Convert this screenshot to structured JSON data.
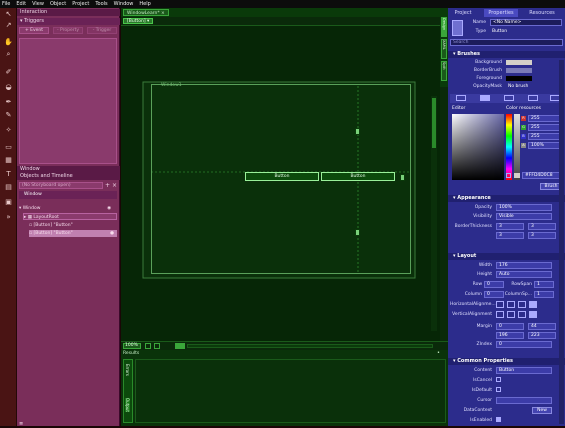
{
  "menu": [
    "File",
    "Edit",
    "View",
    "Object",
    "Project",
    "Tools",
    "Window",
    "Help"
  ],
  "toolbox": {
    "icons": [
      "pointer-icon",
      "direct-select-icon",
      "pan-icon",
      "zoom-icon",
      "eyedropper-icon",
      "paint-bucket-icon",
      "pen-icon",
      "pencil-icon",
      "brush-transform-icon",
      "rectangle-icon",
      "grid-icon",
      "text-icon",
      "textblock-icon",
      "camera-icon",
      "assets-icon"
    ]
  },
  "interaction": {
    "title": "Interaction",
    "triggers_label": "Triggers",
    "event_button": "+ Event",
    "trigger_btn2": "- Property",
    "trigger_btn3": "- Trigger",
    "default_item": "Window",
    "objects_title": "Objects and Timeline",
    "search_placeholder": "(No Storyboard open)",
    "tree": [
      "Window",
      "LayoutRoot",
      "[Button] \"Button\"",
      "[Button] \"Button\""
    ]
  },
  "document": {
    "tab": "WindowLearn*",
    "crumb": "[Button] ▾",
    "window_label": "Window1",
    "button1": "Button",
    "button2": "Button",
    "zoom": "100%",
    "side_tabs": [
      "Design",
      "XAML",
      "Split"
    ]
  },
  "results": {
    "title": "Results",
    "tabs": [
      "Errors",
      "Output"
    ]
  },
  "properties": {
    "tabs": [
      "Project",
      "Properties",
      "Resources"
    ],
    "name_label": "Name",
    "name_value": "<No Name>",
    "type_label": "Type",
    "type_value": "Button",
    "search_placeholder": "Search",
    "brushes_title": "Brushes",
    "brushes": [
      "Background",
      "BorderBrush",
      "Foreground",
      "OpacityMask"
    ],
    "opacity_mask_value": "No brush",
    "editor_label": "Editor",
    "color_resources": "Color resources",
    "rgba": [
      {
        "k": "R",
        "v": "255"
      },
      {
        "k": "G",
        "v": "255"
      },
      {
        "k": "B",
        "v": "255"
      },
      {
        "k": "A",
        "v": "100%"
      }
    ],
    "hex": "#FFD4D0C8",
    "brush_btn": "Brush",
    "appearance_title": "Appearance",
    "opacity_label": "Opacity",
    "opacity_value": "100%",
    "visibility_label": "Visibility",
    "visibility_value": "Visible",
    "border_label": "BorderThickness",
    "border_values": [
      "3",
      "3",
      "3",
      "3"
    ],
    "layout_title": "Layout",
    "width_label": "Width",
    "width_value": "176",
    "height_label": "Height",
    "height_value": "Auto",
    "row_label": "Row",
    "row_value": "0",
    "rowspan_label": "RowSpan",
    "rowspan_value": "1",
    "column_label": "Column",
    "column_value": "0",
    "colspan_label": "ColumnSp...",
    "colspan_value": "1",
    "halign_label": "HorizontalAlignme...",
    "valign_label": "VerticalAlignment",
    "margin_label": "Margin",
    "margin_values": [
      "0",
      "44",
      "196",
      "223"
    ],
    "zindex_label": "ZIndex",
    "zindex_value": "0",
    "common_title": "Common Properties",
    "content_label": "Content",
    "content_value": "Button",
    "iscancel_label": "IsCancel",
    "isdefault_label": "IsDefault",
    "cursor_label": "Cursor",
    "datacontext_label": "DataContext",
    "new_btn": "New",
    "isenabled_label": "IsEnabled"
  }
}
